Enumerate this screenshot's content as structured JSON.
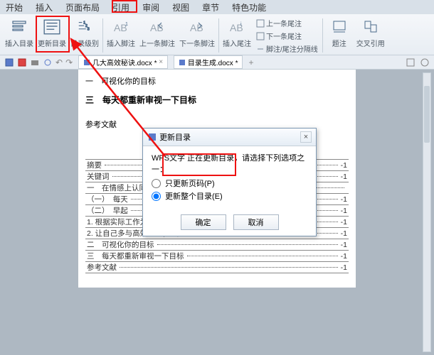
{
  "menu": {
    "items": [
      "开始",
      "插入",
      "页面布局",
      "引用",
      "审阅",
      "视图",
      "章节",
      "特色功能"
    ]
  },
  "ribbon": {
    "g1": {
      "label": "插入目录"
    },
    "g2": {
      "label": "更新目录"
    },
    "g3": {
      "label": "目录级别"
    },
    "g4": {
      "label": "插入脚注"
    },
    "g5": {
      "label": "上一条脚注"
    },
    "g6": {
      "label": "下一条脚注"
    },
    "g7": {
      "label": "插入尾注"
    },
    "b1": "上一条尾注",
    "b2": "下一条尾注",
    "b3": "脚注/尾注分隔线",
    "g8": {
      "label": "题注"
    },
    "g9": {
      "label": "交叉引用"
    }
  },
  "qat": {
    "tab1": "几大高效秘诀.docx *",
    "tab2": "目录生成.docx *"
  },
  "doc": {
    "l1": "一　可视化你的目标",
    "l2": "三　每天都重新审视一下目标",
    "l3": "参考文献",
    "toc": [
      {
        "t": "摘要",
        "p": "-1"
      },
      {
        "t": "关键词",
        "p": "-1"
      },
      {
        "t": "一　在情感上认同",
        "p": ""
      },
      {
        "t": "（一）　每天",
        "p": "-1"
      },
      {
        "t": "（二）　早起",
        "p": "-1"
      },
      {
        "t": "1. 根据实际工作为身体补充能量",
        "p": "-1"
      },
      {
        "t": "2. 让自己多与高效人士在一起",
        "p": "-1"
      },
      {
        "t": "二　可视化你的目标",
        "p": "-1"
      },
      {
        "t": "三　每天都重新审视一下目标",
        "p": "-1"
      },
      {
        "t": "参考文献",
        "p": "-1"
      }
    ]
  },
  "dialog": {
    "title": "更新目录",
    "msg": "WPS文字 正在更新目录，请选择下列选项之一：",
    "opt1": "只更新页码(P)",
    "opt2": "更新整个目录(E)",
    "ok": "确定",
    "cancel": "取消"
  }
}
